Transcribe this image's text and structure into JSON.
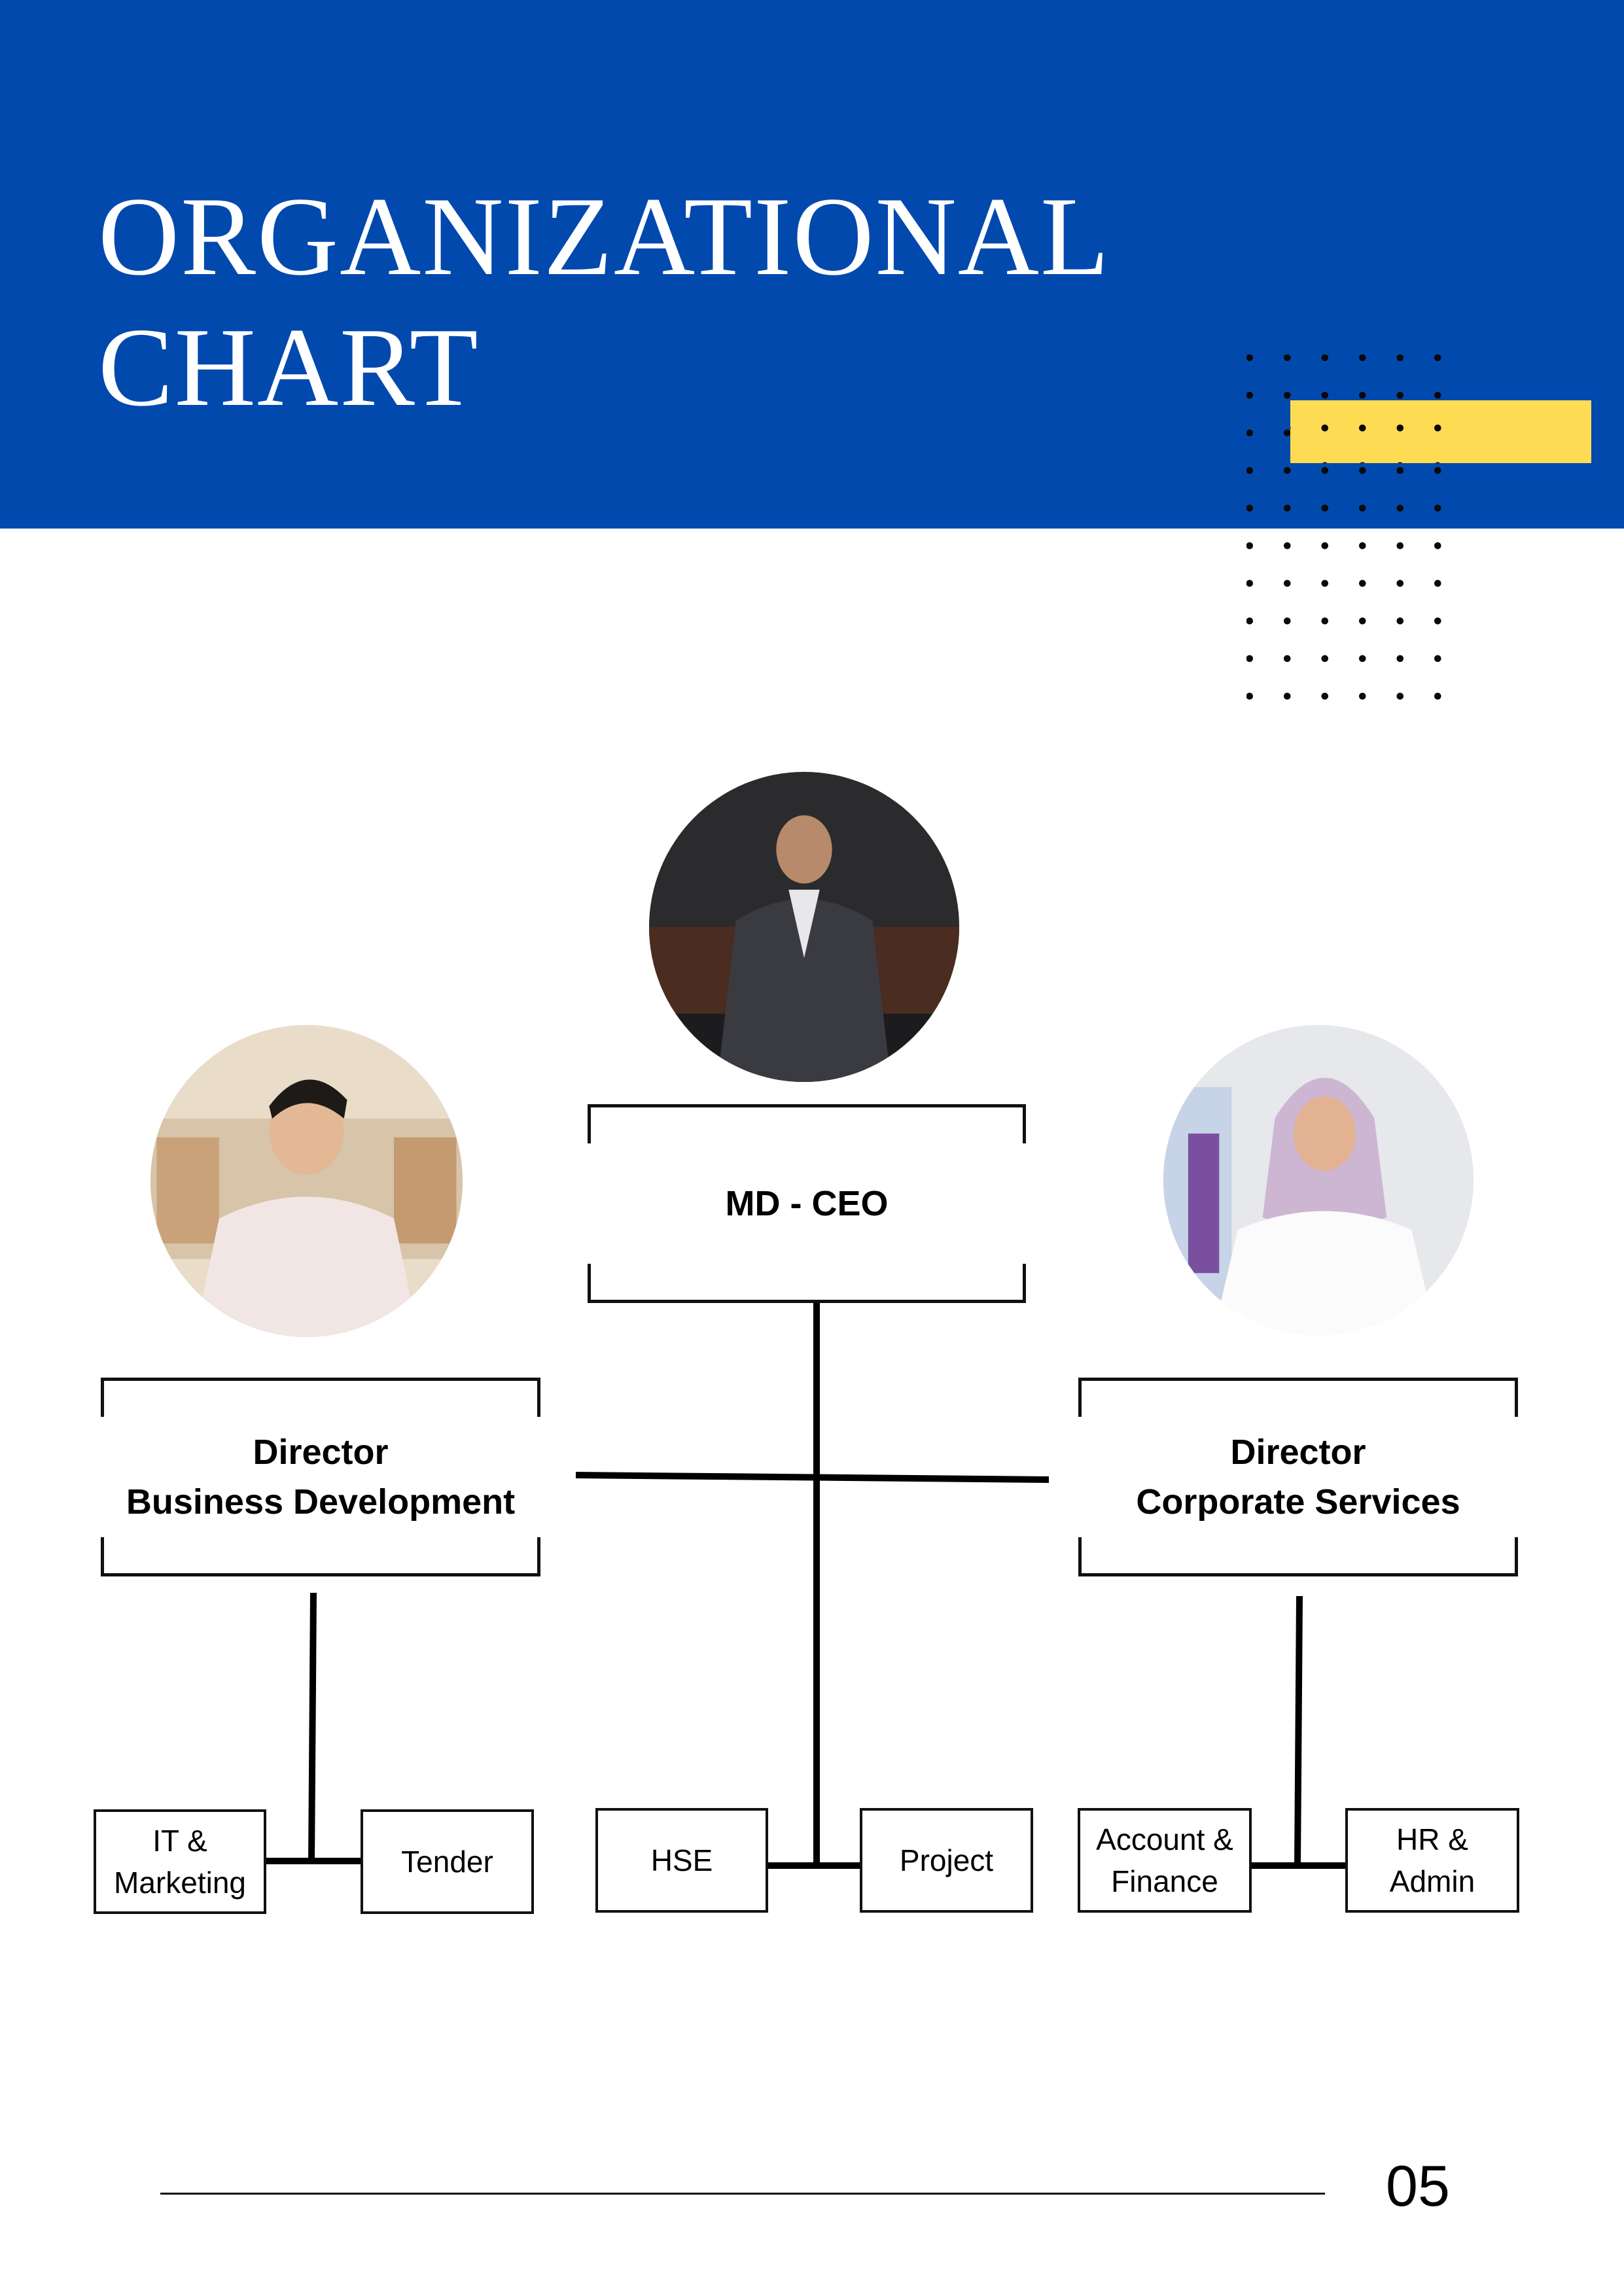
{
  "header": {
    "title_line1": "ORGANIZATIONAL",
    "title_line2": "CHART",
    "band_color": "#0249ad",
    "accent_color": "#fddc54"
  },
  "chart": {
    "ceo": {
      "label": "MD - CEO"
    },
    "directors": [
      {
        "label": "Director\nBusiness Development"
      },
      {
        "label": "Director\nCorporate Services"
      }
    ],
    "departments": [
      {
        "label": "IT &\nMarketing"
      },
      {
        "label": "Tender"
      },
      {
        "label": "HSE"
      },
      {
        "label": "Project"
      },
      {
        "label": "Account &\nFinance"
      },
      {
        "label": "HR &\nAdmin"
      }
    ]
  },
  "footer": {
    "page_number": "05"
  }
}
